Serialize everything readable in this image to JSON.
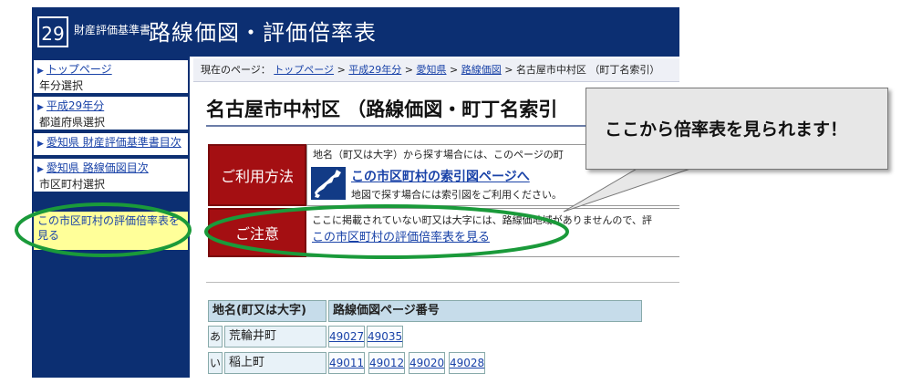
{
  "header": {
    "era_badge": "29",
    "small_title": "財産評価基準書",
    "big_title": "路線価図・評価倍率表"
  },
  "sidebar": {
    "items": [
      {
        "label": "トップページ",
        "sub": "年分選択"
      },
      {
        "label": "平成29年分",
        "sub": "都道府県選択"
      },
      {
        "label": "愛知県 財産評価基準書目次",
        "sub": ""
      },
      {
        "label": "愛知県 路線価図目次",
        "sub": "市区町村選択"
      }
    ],
    "eval_link": "この市区町村の評価倍率表を見る"
  },
  "breadcrumb": {
    "prefix": "現在のページ：",
    "items": [
      "トップページ",
      "平成29年分",
      "愛知県",
      "路線価図"
    ],
    "separator": ">",
    "current": "名古屋市中村区 （町丁名索引）"
  },
  "page_title": "名古屋市中村区 （路線価図・町丁名索引",
  "usage": {
    "label": "ご利用方法",
    "text": "地名（町又は大字）から探す場合には、このページの町",
    "link": "この市区町村の索引図ページへ",
    "note": "地図で探す場合には索引図をご利用ください。"
  },
  "caution": {
    "label": "ご注意",
    "text": "ここに掲載されていない町又は大字には、路線価地域がありませんので、評",
    "link": "この市区町村の評価倍率表を見る"
  },
  "table": {
    "headers": [
      "地名(町又は大字)",
      "路線価図ページ番号"
    ],
    "rows": [
      {
        "kana": "あ",
        "name": "荒輪井町",
        "pages": [
          "49027",
          "49035"
        ]
      },
      {
        "kana": "い",
        "name": "稲上町",
        "pages": [
          "49011",
          "49012",
          "49020",
          "49028"
        ]
      }
    ]
  },
  "callout": {
    "text": "ここから倍率表を見られます！"
  },
  "colors": {
    "navy": "#0c2f72",
    "red": "#a40f12",
    "highlight_green": "#1a9a3a",
    "highlight_yellow": "#ffff99"
  }
}
